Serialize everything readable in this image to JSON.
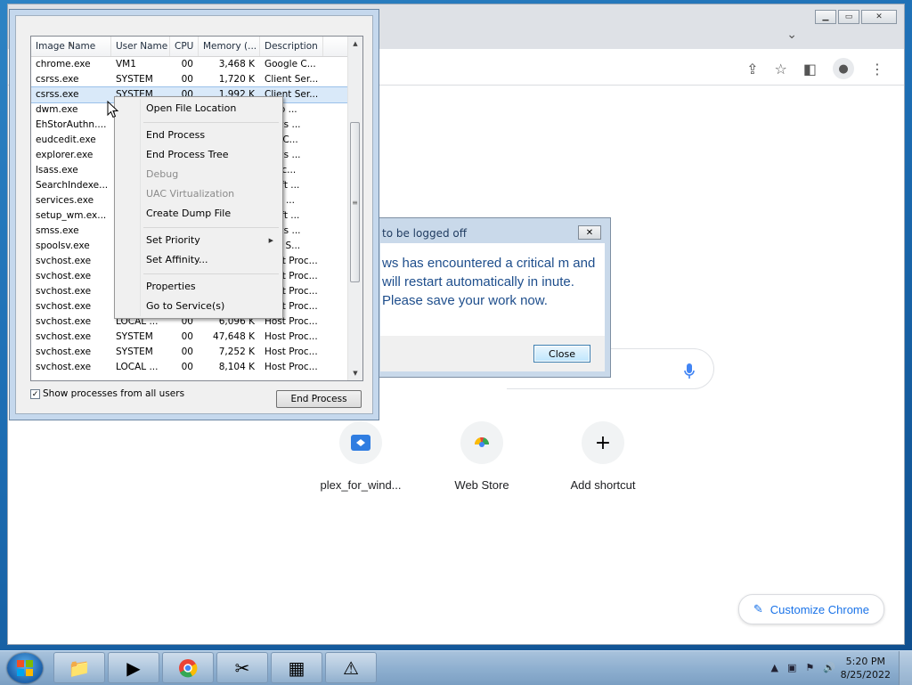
{
  "taskmgr": {
    "columns": [
      "Image Name",
      "User Name",
      "CPU",
      "Memory (...",
      "Description"
    ],
    "rows": [
      {
        "name": "chrome.exe",
        "user": "VM1",
        "cpu": "00",
        "mem": "3,468 K",
        "desc": "Google C..."
      },
      {
        "name": "csrss.exe",
        "user": "SYSTEM",
        "cpu": "00",
        "mem": "1,720 K",
        "desc": "Client Ser..."
      },
      {
        "name": "csrss.exe",
        "user": "SYSTEM",
        "cpu": "00",
        "mem": "1,992 K",
        "desc": "Client Ser..."
      },
      {
        "name": "dwm.exe",
        "user": "",
        "cpu": "",
        "mem": "",
        "desc": "ktop ..."
      },
      {
        "name": "EhStorAuthn....",
        "user": "",
        "cpu": "",
        "mem": "",
        "desc": "dows ..."
      },
      {
        "name": "eudcedit.exe",
        "user": "",
        "cpu": "",
        "mem": "",
        "desc": "ate C..."
      },
      {
        "name": "explorer.exe",
        "user": "",
        "cpu": "",
        "mem": "",
        "desc": "dows ..."
      },
      {
        "name": "lsass.exe",
        "user": "",
        "cpu": "",
        "mem": "",
        "desc": "l Sec..."
      },
      {
        "name": "SearchIndexe...",
        "user": "",
        "cpu": "",
        "mem": "",
        "desc": "osoft ..."
      },
      {
        "name": "services.exe",
        "user": "",
        "cpu": "",
        "mem": "",
        "desc": "ices ..."
      },
      {
        "name": "setup_wm.ex...",
        "user": "",
        "cpu": "",
        "mem": "",
        "desc": "osoft ..."
      },
      {
        "name": "smss.exe",
        "user": "",
        "cpu": "",
        "mem": "",
        "desc": "dows ..."
      },
      {
        "name": "spoolsv.exe",
        "user": "",
        "cpu": "",
        "mem": "",
        "desc": "oler S..."
      },
      {
        "name": "svchost.exe",
        "user": "",
        "cpu": "",
        "mem": "",
        "desc": "Host Proc..."
      },
      {
        "name": "svchost.exe",
        "user": "",
        "cpu": "",
        "mem": "",
        "desc": "Host Proc..."
      },
      {
        "name": "svchost.exe",
        "user": "",
        "cpu": "",
        "mem": "",
        "desc": "Host Proc..."
      },
      {
        "name": "svchost.exe",
        "user": "",
        "cpu": "",
        "mem": "",
        "desc": "Host Proc..."
      },
      {
        "name": "svchost.exe",
        "user": "LOCAL ...",
        "cpu": "00",
        "mem": "6,096 K",
        "desc": "Host Proc..."
      },
      {
        "name": "svchost.exe",
        "user": "SYSTEM",
        "cpu": "00",
        "mem": "47,648 K",
        "desc": "Host Proc..."
      },
      {
        "name": "svchost.exe",
        "user": "SYSTEM",
        "cpu": "00",
        "mem": "7,252 K",
        "desc": "Host Proc..."
      },
      {
        "name": "svchost.exe",
        "user": "LOCAL ...",
        "cpu": "00",
        "mem": "8,104 K",
        "desc": "Host Proc..."
      }
    ],
    "show_all_label": "Show processes from all users",
    "show_all_checked": "✓",
    "end_process_label": "End Process"
  },
  "context_menu": {
    "open_file_location": "Open File Location",
    "end_process": "End Process",
    "end_process_tree": "End Process Tree",
    "debug": "Debug",
    "uac_virtualization": "UAC Virtualization",
    "create_dump_file": "Create Dump File",
    "set_priority": "Set Priority",
    "set_affinity": "Set Affinity...",
    "properties": "Properties",
    "go_to_services": "Go to Service(s)"
  },
  "logoff_dialog": {
    "title": "to be logged off",
    "message": "ws has encountered a critical m and will restart automatically in inute. Please save your work now.",
    "close_label": "Close"
  },
  "chrome": {
    "shortcuts": [
      {
        "label": "plex_for_wind...",
        "icon": "plex-icon"
      },
      {
        "label": "Web Store",
        "icon": "web-store-icon"
      },
      {
        "label": "Add shortcut",
        "icon": "plus-icon"
      }
    ],
    "customize_label": "Customize Chrome"
  },
  "taskbar": {
    "time": "5:20 PM",
    "date": "8/25/2022"
  }
}
